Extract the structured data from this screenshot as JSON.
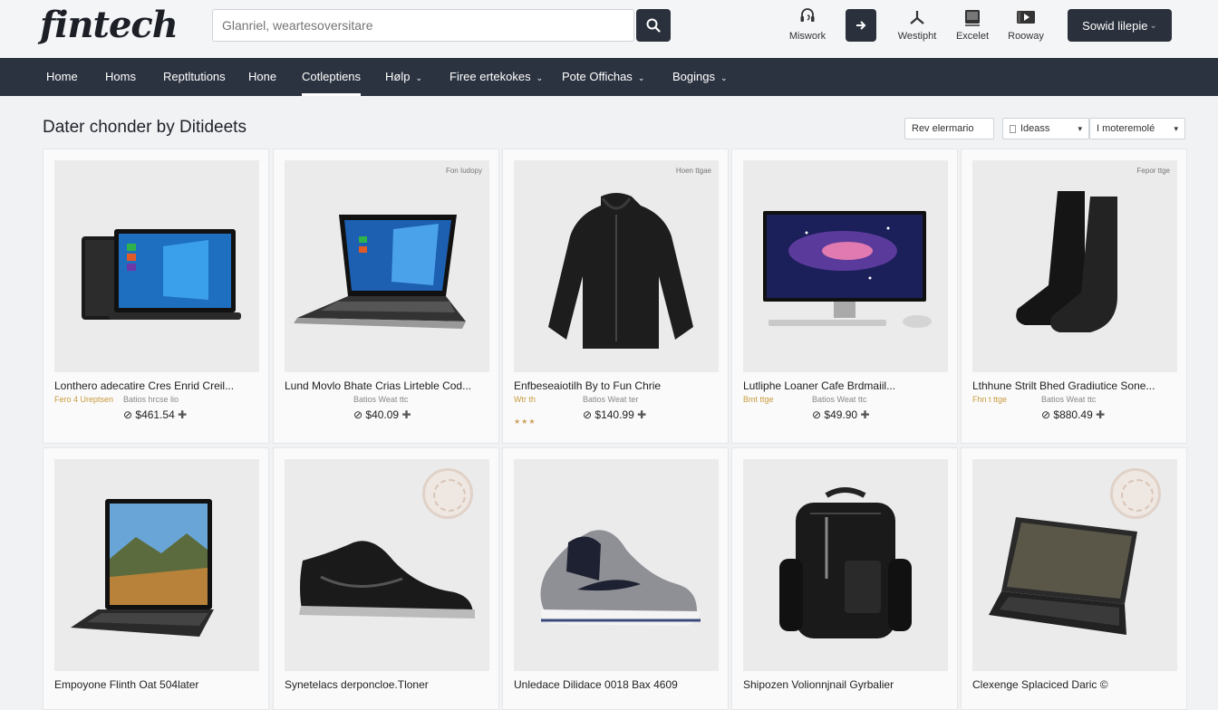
{
  "brand": {
    "logo": "fintech"
  },
  "search": {
    "placeholder": "Glanriel, weartesoversitare"
  },
  "toolbar": {
    "tools": [
      {
        "label": "Miswork",
        "icon": "headset-icon"
      },
      {
        "label": "Westipht",
        "icon": "share-icon"
      },
      {
        "label": "Excelet",
        "icon": "tablet-icon"
      },
      {
        "label": "Rooway",
        "icon": "film-icon"
      }
    ],
    "signin_label": "Sowid lilepie",
    "signin_chev": "⌄"
  },
  "nav": {
    "items": [
      {
        "label": "Home",
        "dropdown": false
      },
      {
        "label": "Homs",
        "dropdown": false
      },
      {
        "label": "Reptltutions",
        "dropdown": false
      },
      {
        "label": "Hone",
        "dropdown": false
      },
      {
        "label": "Cotleptiens",
        "dropdown": false,
        "active": true
      },
      {
        "label": "Hølp",
        "dropdown": true
      },
      {
        "label": "Firee ertekokes",
        "dropdown": true
      },
      {
        "label": "Pote Offichas",
        "dropdown": true
      },
      {
        "label": "Bogings",
        "dropdown": true
      }
    ],
    "chevron": "⌄"
  },
  "main": {
    "heading": "Dater chonder by Ditideets",
    "filters": {
      "sort_label": "Rev elermario",
      "view_label": "Ideass",
      "per_page_label": "I moteremolé",
      "chev": "▾"
    }
  },
  "products": [
    {
      "title": "Lonthero adecatire Cres Enrid Creil...",
      "vendor": "Fero 4 Ureptsen",
      "subvendor": "Batios hrcse lio",
      "price": "$461.54",
      "badge": "",
      "product": "laptop-tablet"
    },
    {
      "title": "Lund Movlo Bhate Crias Lirteble Cod...",
      "vendor": "",
      "subvendor": "Batios Weat ttc",
      "price": "$40.09",
      "badge": "Fon Iudopy",
      "product": "laptop"
    },
    {
      "title": "Enfbeseaiotilh By to Fun Chrie",
      "vendor": "Wtr th",
      "subvendor": "Batios Weat ter",
      "price": "$140.99",
      "badge": "Hoen ttgae",
      "product": "jacket",
      "stars": "★★★"
    },
    {
      "title": "Lutliphe Loaner Cafe Brdmaiil...",
      "vendor": "Bmt ttge",
      "subvendor": "Batios Weat ttc",
      "price": "$49.90",
      "badge": "",
      "product": "monitor"
    },
    {
      "title": "Lthhune Strilt Bhed Gradiutice Sone...",
      "vendor": "Fhn t ttge",
      "subvendor": "Batios Weat ttc",
      "price": "$880.49",
      "badge": "Fepor ttge",
      "product": "socks"
    },
    {
      "title": "Empoyone Flinth Oat 504later",
      "product": "laptop-landscape"
    },
    {
      "title": "Synetelacs derponcloe.Tloner",
      "product": "sneaker-black",
      "seal": true
    },
    {
      "title": "Unledace Dilidace 0018 Bax 4609",
      "product": "sneaker-grey"
    },
    {
      "title": "Shipozen Volionnjnail Gyrbalier",
      "product": "backpack"
    },
    {
      "title": "Clexenge Splaciced Daric ©",
      "product": "laptop-dark",
      "seal": true
    }
  ],
  "colors": {
    "nav_bg": "#2c3340",
    "accent_dark": "#2b313c",
    "page_bg": "#f1f2f4"
  }
}
